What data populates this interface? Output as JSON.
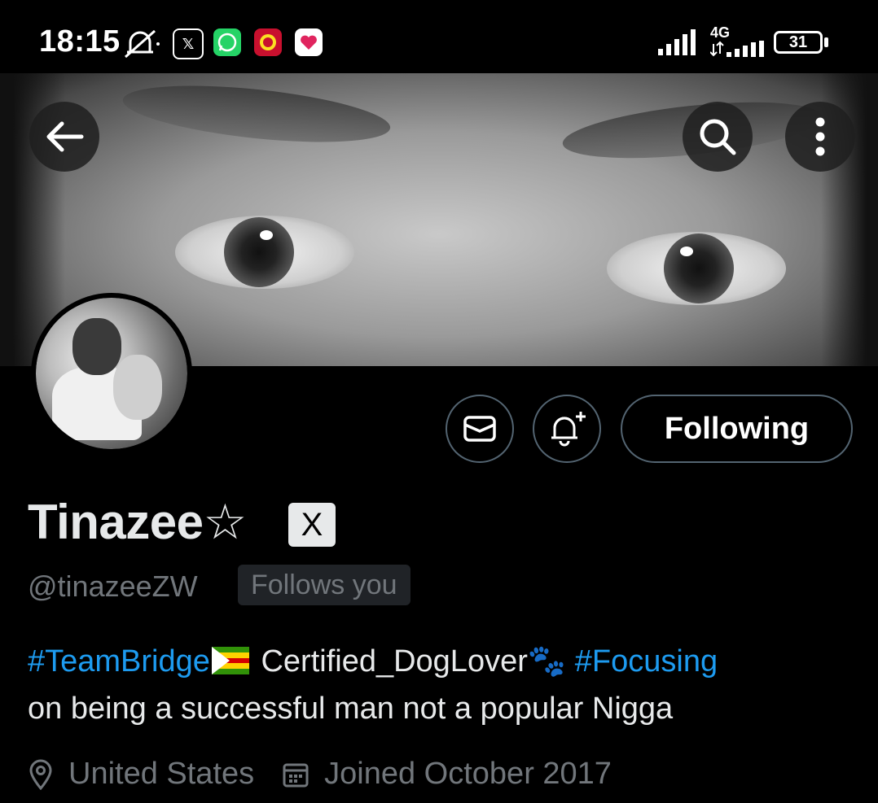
{
  "status_bar": {
    "time": "18:15",
    "network": "4G",
    "battery": "31",
    "notification_icons": [
      "mute-bell-icon",
      "x-app-icon",
      "whatsapp-icon",
      "man-utd-icon",
      "heart-app-icon"
    ]
  },
  "header": {
    "back_icon": "arrow-left-icon",
    "search_icon": "search-icon",
    "more_icon": "more-vertical-icon"
  },
  "profile": {
    "display_name": "Tinazee☆",
    "badge_text": "X",
    "handle": "@tinazeeZW",
    "follows_you": "Follows you",
    "following_label": "Following",
    "bio": {
      "hashtag1": "#TeamBridge",
      "text1": " Certified_DogLover",
      "paw": "🐾",
      "hashtag2": "#Focusing",
      "line2": "on being a successful man not a popular Nigga"
    },
    "location": "United States",
    "joined": "Joined October 2017"
  },
  "colors": {
    "accent": "#1d9bf0",
    "muted": "#71767b",
    "text": "#e7e9ea",
    "border": "#536471"
  }
}
